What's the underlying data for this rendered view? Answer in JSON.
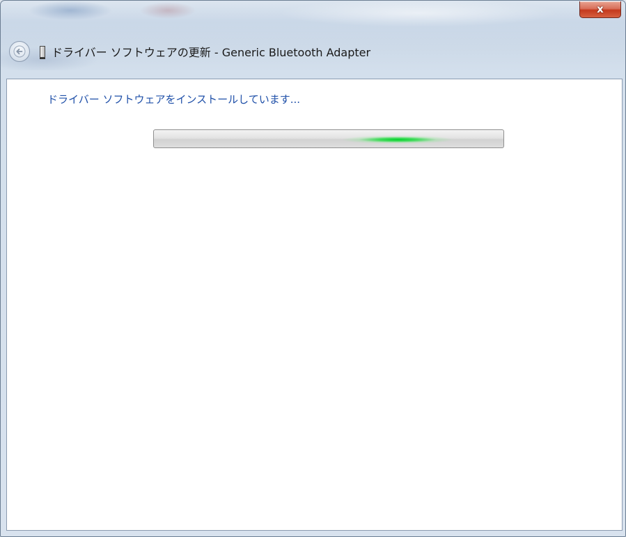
{
  "window": {
    "title": "ドライバー ソフトウェアの更新 - Generic Bluetooth Adapter",
    "close_glyph": "x"
  },
  "content": {
    "status_text": "ドライバー ソフトウェアをインストールしています..."
  },
  "progress": {
    "mode": "indeterminate-marquee",
    "glow_color": "#1fd83a"
  },
  "icons": {
    "back": "back-arrow-icon",
    "device": "device-icon",
    "close": "close-icon"
  },
  "colors": {
    "status_text": "#1e4fa8",
    "close_button": "#c4391d",
    "frame": "#c9d7e7"
  }
}
